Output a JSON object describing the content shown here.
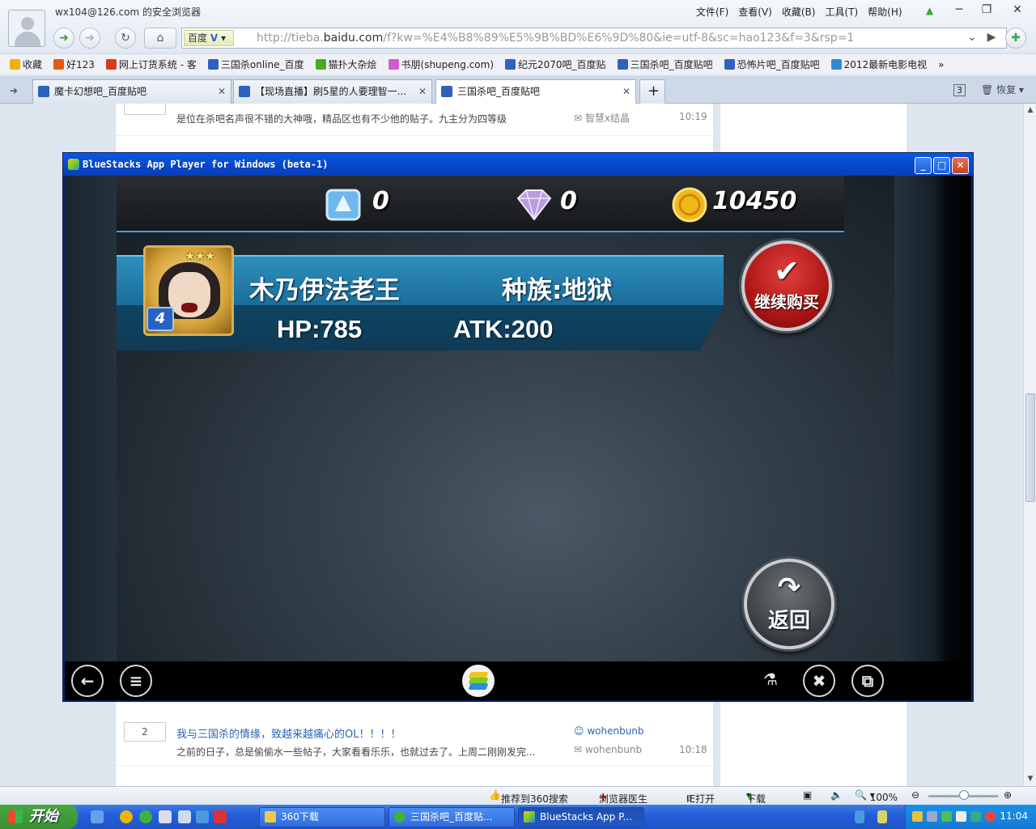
{
  "browser": {
    "account_title": "wx104@126.com 的安全浏览器",
    "menu": [
      "文件(F)",
      "查看(V)",
      "收藏(B)",
      "工具(T)",
      "帮助(H)"
    ],
    "window_controls": [
      "─",
      "❐",
      "✕"
    ],
    "search_engine": "百度",
    "url_prefix": "http://tieba.",
    "url_domain": "baidu.com",
    "url_rest": "/f?kw=%E4%B8%89%E5%9B%BD%E6%9D%80&ie=utf-8&sc=hao123&f=3&rsp=1",
    "bookmarks": [
      {
        "label": "收藏",
        "color": "#f1b000"
      },
      {
        "label": "好123",
        "color": "#e45a12"
      },
      {
        "label": "网上订货系统 - 客",
        "color": "#d93a1c"
      },
      {
        "label": "三国杀online_百度",
        "color": "#3060c0"
      },
      {
        "label": "猫扑大杂烩",
        "color": "#4caa1e"
      },
      {
        "label": "书朋(shupeng.com)",
        "color": "#d25cc8"
      },
      {
        "label": "纪元2070吧_百度贴",
        "color": "#3060c0"
      },
      {
        "label": "三国杀吧_百度贴吧",
        "color": "#3060c0"
      },
      {
        "label": "恐怖片吧_百度贴吧",
        "color": "#3060c0"
      },
      {
        "label": "2012最新电影电视",
        "color": "#2d8ad6"
      }
    ],
    "tabs": [
      {
        "label": "魔卡幻想吧_百度贴吧"
      },
      {
        "label": "【现场直播】刷5星的人要理智一..."
      },
      {
        "label": "三国杀吧_百度贴吧"
      }
    ],
    "tab_restore": "恢复",
    "tab_count": "3"
  },
  "threads": [
    {
      "count": "",
      "title": "",
      "abstract": "是位在杀吧名声很不错的大神哦，精品区也有不少他的贴子。九主分为四等级",
      "author": "",
      "last": "智慧x结晶",
      "time": "10:19"
    },
    {
      "count": "2",
      "title": "我与三国杀的情缘，致越来越痛心的OL！！！！",
      "abstract": "之前的日子，总是偷偷水一些帖子，大家看看乐乐，也就过去了。上周二刚刚发完...",
      "author": "wohenbunb",
      "last": "wohenbunb",
      "time": "10:18"
    }
  ],
  "statusbar": {
    "recommend": "推荐到360搜索",
    "doctor": "浏览器医生",
    "ie_open": "IE打开",
    "download": "下载",
    "zoom": "100%"
  },
  "taskbar": {
    "start": "开始",
    "tasks": [
      "360下载",
      "三国杀吧_百度贴...",
      "BlueStacks App P..."
    ],
    "clock": "11:04"
  },
  "bluestacks": {
    "title": "BlueStacks App Player for Windows (beta-1)",
    "currency": {
      "crystals": "0",
      "diamonds": "0",
      "coins": "10450"
    },
    "card": {
      "stars": "★★★",
      "level": "4",
      "name": "木乃伊法老王",
      "race": "种族:地狱",
      "hp": "HP:785",
      "atk": "ATK:200"
    },
    "buy_button": "继续购买",
    "back_button": "返回"
  },
  "colors": {
    "accent_blue": "#2d64b3",
    "banner_blue": "#2e8fbd",
    "buy_red": "#a81413",
    "taskbar_blue": "#245edb"
  }
}
